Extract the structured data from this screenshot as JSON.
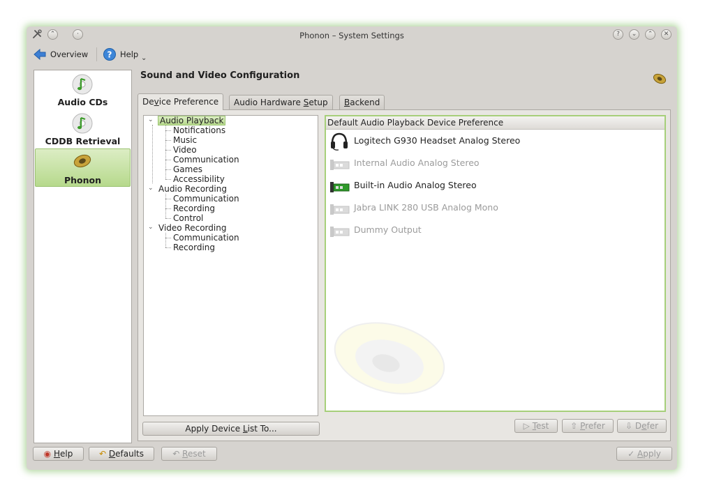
{
  "window": {
    "title": "Phonon – System Settings"
  },
  "toolbar": {
    "overview_label": "Overview",
    "help_label": "Help"
  },
  "sidebar": {
    "items": [
      {
        "label": "Audio CDs"
      },
      {
        "label": "CDDB Retrieval"
      },
      {
        "label": "Phonon",
        "selected": true
      }
    ]
  },
  "main": {
    "title": "Sound and Video Configuration",
    "tabs": [
      {
        "pre": "De",
        "key": "v",
        "post": "ice Preference",
        "active": true
      },
      {
        "pre": "Audio Hardware ",
        "key": "S",
        "post": "etup"
      },
      {
        "pre": "",
        "key": "B",
        "post": "ackend"
      }
    ]
  },
  "tree": {
    "audio_playback": "Audio Playback",
    "audio_playback_children": [
      "Notifications",
      "Music",
      "Video",
      "Communication",
      "Games",
      "Accessibility"
    ],
    "audio_recording": "Audio Recording",
    "audio_recording_children": [
      "Communication",
      "Recording",
      "Control"
    ],
    "video_recording": "Video Recording",
    "video_recording_children": [
      "Communication",
      "Recording"
    ]
  },
  "devices": {
    "header": "Default Audio Playback Device Preference",
    "items": [
      {
        "name": "Logitech G930 Headset Analog Stereo",
        "icon": "headset-icon",
        "enabled": true
      },
      {
        "name": "Internal Audio Analog Stereo",
        "icon": "sound-card-icon",
        "enabled": false
      },
      {
        "name": "Built-in Audio Analog Stereo",
        "icon": "sound-card-icon",
        "enabled": true
      },
      {
        "name": "Jabra LINK 280 USB Analog Mono",
        "icon": "sound-card-icon",
        "enabled": false
      },
      {
        "name": "Dummy Output",
        "icon": "sound-card-icon",
        "enabled": false
      }
    ]
  },
  "buttons": {
    "apply_list": {
      "pre": "Apply Device ",
      "key": "L",
      "post": "ist To..."
    },
    "test": {
      "pre": "",
      "key": "T",
      "post": "est"
    },
    "prefer": {
      "pre": "",
      "key": "P",
      "post": "refer"
    },
    "defer": {
      "pre": "D",
      "key": "e",
      "post": "fer"
    },
    "help": {
      "pre": "",
      "key": "H",
      "post": "elp"
    },
    "defaults": {
      "pre": "",
      "key": "D",
      "post": "efaults"
    },
    "reset": {
      "pre": "",
      "key": "R",
      "post": "eset"
    },
    "apply": {
      "pre": "",
      "key": "A",
      "post": "pply"
    }
  },
  "colors": {
    "selection": "#b7da8d",
    "window_bg": "#d6d3cf",
    "disabled_text": "#9b9b9b",
    "glow": "#78b95a"
  }
}
